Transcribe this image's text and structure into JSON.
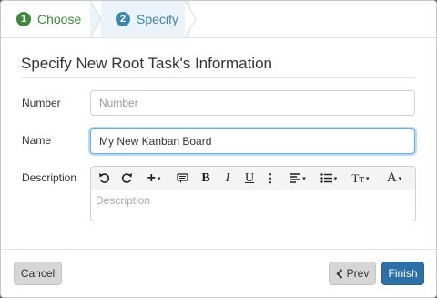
{
  "wizard": {
    "steps": [
      {
        "number": "1",
        "label": "Choose"
      },
      {
        "number": "2",
        "label": "Specify"
      }
    ]
  },
  "form": {
    "title": "Specify New Root Task's Information",
    "number": {
      "label": "Number",
      "placeholder": "Number",
      "value": ""
    },
    "name": {
      "label": "Name",
      "value": "My New Kanban Board"
    },
    "description": {
      "label": "Description",
      "placeholder": "Description"
    }
  },
  "toolbar": {
    "bold": "B",
    "italic": "I",
    "underline": "U",
    "more": "⋮",
    "font_size": "Tт",
    "font_color": "A",
    "caret": "▾",
    "plus": "+"
  },
  "footer": {
    "cancel_label": "Cancel",
    "prev_label": "Prev",
    "finish_label": "Finish"
  },
  "colors": {
    "step_done": "#3c8a3c",
    "step_active": "#3a87ad",
    "finish_button": "#2e6fa8",
    "focus_ring": "#66afe9"
  }
}
